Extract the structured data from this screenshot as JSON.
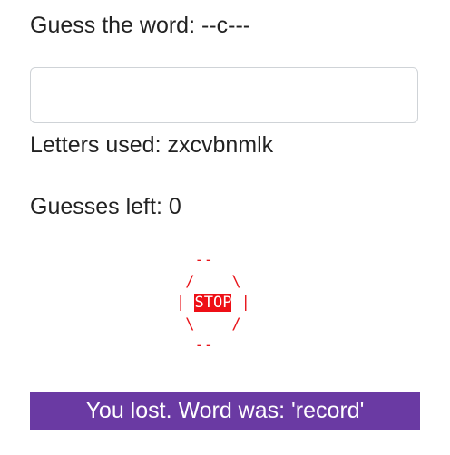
{
  "game": {
    "prompt": "Guess the word: --c---",
    "input_value": "",
    "letters_used": "Letters used: zxcvbnmlk",
    "guesses_left": "Guesses left: 0",
    "stop_sign": {
      "top": "  --",
      "upper": " /    \\",
      "left_bar": "| ",
      "word": "STOP",
      "right_bar": " |",
      "lower": " \\    /",
      "bottom": "  --",
      "color": "#e8151b"
    },
    "result_banner": "You lost. Word was: 'record'",
    "banner_color": "#6a3aa3"
  }
}
